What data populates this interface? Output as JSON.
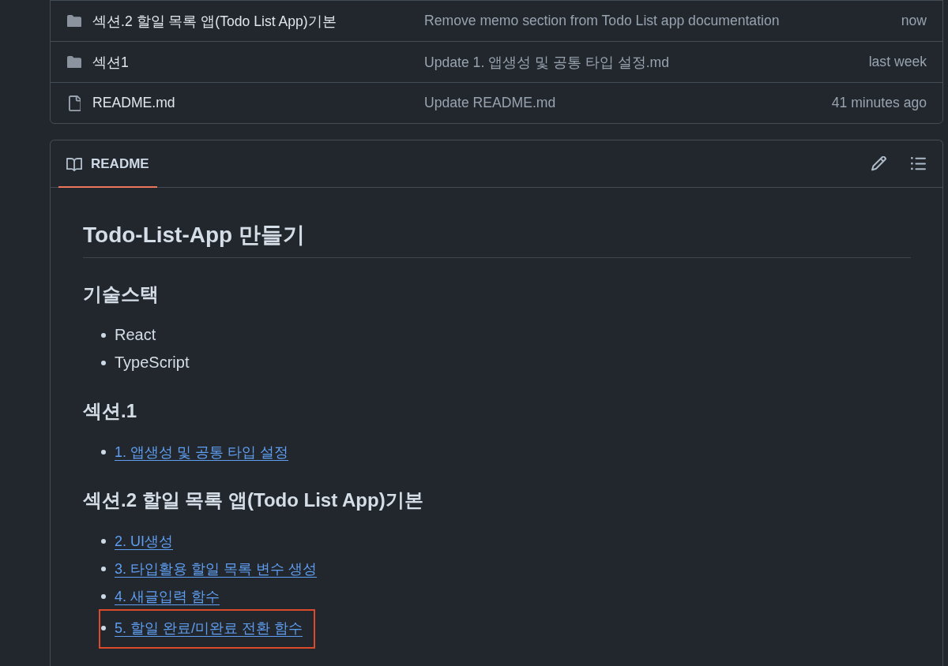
{
  "files": [
    {
      "kind": "folder",
      "name": "섹션.2 할일 목록 앱(Todo List App)기본",
      "commit_message": "Remove memo section from Todo List app documentation",
      "time": "now"
    },
    {
      "kind": "folder",
      "name": "섹션1",
      "commit_message": "Update 1. 앱생성 및 공통 타입 설정.md",
      "time": "last week"
    },
    {
      "kind": "file",
      "name": "README.md",
      "commit_message": "Update README.md",
      "time": "41 minutes ago"
    }
  ],
  "readme": {
    "tab": {
      "label": "README",
      "selected": true
    },
    "title": "Todo-List-App 만들기",
    "sections": [
      {
        "heading": "기술스택",
        "items": [
          {
            "kind": "text",
            "text": "React",
            "highlighted": false
          },
          {
            "kind": "text",
            "text": "TypeScript",
            "highlighted": false
          }
        ]
      },
      {
        "heading": "섹션.1",
        "items": [
          {
            "kind": "link",
            "text": "1. 앱생성 및 공통 타입 설정",
            "highlighted": false
          }
        ]
      },
      {
        "heading": "섹션.2 할일 목록 앱(Todo List App)기본",
        "items": [
          {
            "kind": "link",
            "text": "2. UI생성",
            "highlighted": false
          },
          {
            "kind": "link",
            "text": "3. 타입활용 할일 목록 변수 생성",
            "highlighted": false
          },
          {
            "kind": "link",
            "text": "4. 새글입력 함수",
            "highlighted": false
          },
          {
            "kind": "link",
            "text": "5. 할일 완료/미완료 전환 함수",
            "highlighted": true
          }
        ]
      }
    ]
  }
}
